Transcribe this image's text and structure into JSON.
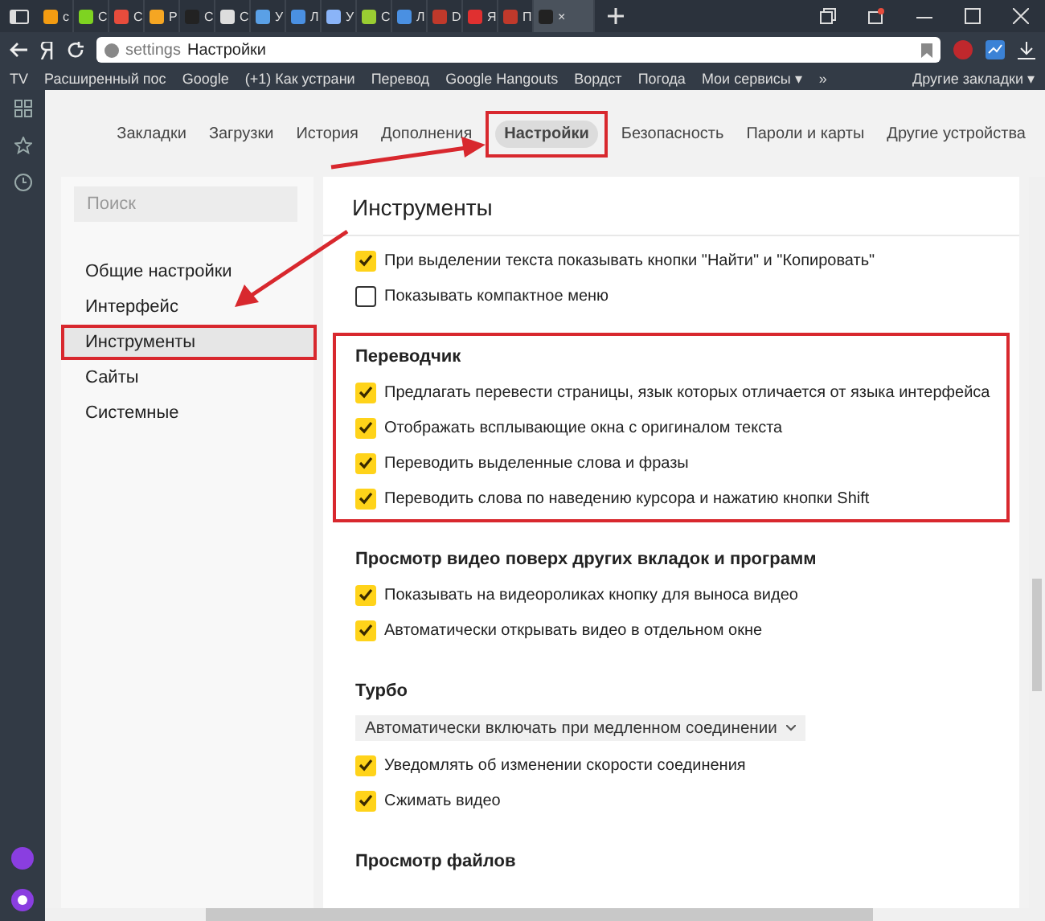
{
  "browser": {
    "tabs": [
      {
        "label": "с",
        "selected": false
      },
      {
        "label": "С",
        "selected": false
      },
      {
        "label": "С",
        "selected": false
      },
      {
        "label": "Р",
        "selected": false
      },
      {
        "label": "С",
        "selected": false
      },
      {
        "label": "С",
        "selected": false
      },
      {
        "label": "У",
        "selected": false
      },
      {
        "label": "Л",
        "selected": false
      },
      {
        "label": "У",
        "selected": false
      },
      {
        "label": "С",
        "selected": false
      },
      {
        "label": "Л",
        "selected": false
      },
      {
        "label": "D",
        "selected": false
      },
      {
        "label": "Я",
        "selected": false
      },
      {
        "label": "П",
        "selected": false
      },
      {
        "label": "×",
        "selected": true
      }
    ],
    "address": {
      "scheme": "settings",
      "title": "Настройки"
    },
    "bookmarks": [
      {
        "label": "TV"
      },
      {
        "label": "Расширенный пос"
      },
      {
        "label": "Google"
      },
      {
        "label": "(+1) Как устрани"
      },
      {
        "label": "Перевод"
      },
      {
        "label": "Google Hangouts"
      },
      {
        "label": "Вордст"
      },
      {
        "label": "Погода"
      },
      {
        "label": "Мои сервисы ▾"
      },
      {
        "label": "»"
      }
    ],
    "other_bookmarks": "Другие закладки ▾"
  },
  "nav": [
    {
      "label": "Закладки",
      "selected": false,
      "highlighted": false
    },
    {
      "label": "Загрузки",
      "selected": false,
      "highlighted": false
    },
    {
      "label": "История",
      "selected": false,
      "highlighted": false
    },
    {
      "label": "Дополнения",
      "selected": false,
      "highlighted": false
    },
    {
      "label": "Настройки",
      "selected": true,
      "highlighted": true
    },
    {
      "label": "Безопасность",
      "selected": false,
      "highlighted": false
    },
    {
      "label": "Пароли и карты",
      "selected": false,
      "highlighted": false
    },
    {
      "label": "Другие устройства",
      "selected": false,
      "highlighted": false
    }
  ],
  "sidebar": {
    "search": {
      "placeholder": "Поиск"
    },
    "items": [
      {
        "label": "Общие настройки",
        "selected": false,
        "highlighted": false
      },
      {
        "label": "Интерфейс",
        "selected": false,
        "highlighted": false
      },
      {
        "label": "Инструменты",
        "selected": true,
        "highlighted": true
      },
      {
        "label": "Сайты",
        "selected": false,
        "highlighted": false
      },
      {
        "label": "Системные",
        "selected": false,
        "highlighted": false
      }
    ]
  },
  "content": {
    "title": "Инструменты",
    "sections": [
      {
        "options": [
          {
            "kind": "checkbox",
            "label": "При выделении текста показывать кнопки \"Найти\" и \"Копировать\"",
            "checked": true
          },
          {
            "kind": "checkbox",
            "label": "Показывать компактное меню",
            "checked": false
          }
        ]
      },
      {
        "title": "Переводчик",
        "highlighted": true,
        "options": [
          {
            "kind": "checkbox",
            "label": "Предлагать перевести страницы, язык которых отличается от языка интерфейса",
            "checked": true
          },
          {
            "kind": "checkbox",
            "label": "Отображать всплывающие окна с оригиналом текста",
            "checked": true
          },
          {
            "kind": "checkbox",
            "label": "Переводить выделенные слова и фразы",
            "checked": true
          },
          {
            "kind": "checkbox",
            "label": "Переводить слова по наведению курсора и нажатию кнопки Shift",
            "checked": true
          }
        ]
      },
      {
        "title": "Просмотр видео поверх других вкладок и программ",
        "options": [
          {
            "kind": "checkbox",
            "label": "Показывать на видеороликах кнопку для выноса видео",
            "checked": true
          },
          {
            "kind": "checkbox",
            "label": "Автоматически открывать видео в отдельном окне",
            "checked": true
          }
        ]
      },
      {
        "title": "Турбо",
        "options": [
          {
            "kind": "select",
            "label": "Автоматически включать при медленном соединении"
          },
          {
            "kind": "checkbox",
            "label": "Уведомлять об изменении скорости соединения",
            "checked": true
          },
          {
            "kind": "checkbox",
            "label": "Сжимать видео",
            "checked": true
          }
        ]
      },
      {
        "title": "Просмотр файлов"
      }
    ]
  }
}
